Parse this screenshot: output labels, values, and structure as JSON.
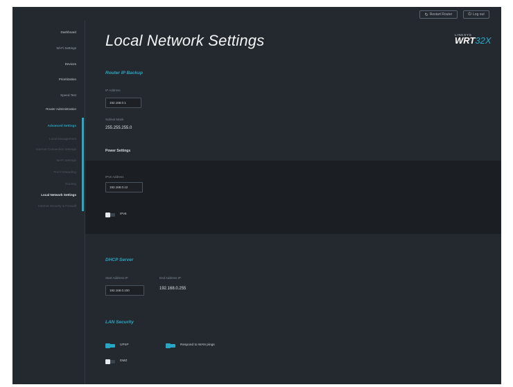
{
  "topbar": {
    "restart_label": "Restart Router",
    "logout_label": "Log out"
  },
  "sidebar": {
    "items": [
      {
        "label": "Dashboard"
      },
      {
        "label": "Wi-Fi Settings"
      },
      {
        "label": "Devices"
      },
      {
        "label": "Prioritization"
      },
      {
        "label": "Speed Test"
      },
      {
        "label": "Router Administration"
      },
      {
        "label": "Advanced Settings"
      },
      {
        "label": "Local Management"
      },
      {
        "label": "Internet Connection Settings"
      },
      {
        "label": "Wi-Fi Settings"
      },
      {
        "label": "Port Forwarding"
      },
      {
        "label": "Routing"
      },
      {
        "label": "Local Network Settings"
      },
      {
        "label": "Internet Security & Firewall"
      }
    ]
  },
  "page": {
    "title": "Local Network Settings"
  },
  "logo": {
    "top": "LINKSYS",
    "main": "WRT",
    "accent": "32X"
  },
  "router_ip": {
    "section_title": "Router IP Backup",
    "ip_label": "IP Address",
    "ip_value": "192.168.0.1",
    "subnet_label": "Subnet Mask",
    "subnet_value": "255.255.255.0",
    "power_label": "Power Settings"
  },
  "ipv6": {
    "ip_label": "IPv6 Address",
    "ip_value": "192.168.0.12",
    "toggle_label": "IPv6",
    "toggle_on": false
  },
  "dhcp": {
    "section_title": "DHCP Server",
    "start_label": "Start Address IP",
    "start_value": "192.168.0.100",
    "end_label": "End Address IP",
    "end_value": "192.168.0.255"
  },
  "lan_security": {
    "section_title": "LAN Security",
    "upnp_label": "UPnP",
    "upnp_on": true,
    "wan_ping_label": "Respond to WAN pings",
    "wan_ping_on": true,
    "dmz_label": "DMZ",
    "dmz_on": false
  },
  "colors": {
    "accent": "#2aa7c4",
    "background": "#24292f",
    "band": "#1b1e22"
  }
}
